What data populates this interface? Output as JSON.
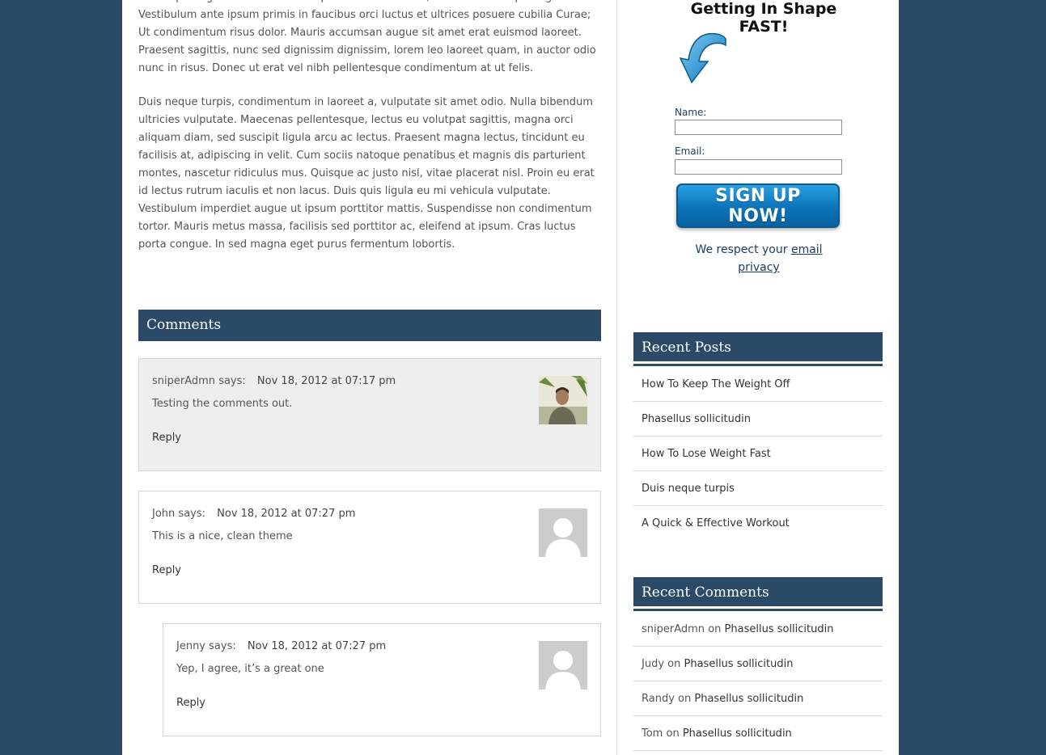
{
  "article": {
    "paragraphs": [
      "nisl adipiscing fermentum. Lorem ipsum dolor sit amet, consectetur adipiscing elit. Vestibulum ante ipsum primis in faucibus orci luctus et ultrices posuere cubilia Curae; Ut condimentum risus dolor. Mauris accumsan augue sit amet erat euismod laoreet. Praesent sagittis, nunc sed dignissim dignissim, lorem leo laoreet quam, in auctor odio nunc in risus. Donec ut erat vel nibh pellentesque condimentum at ut felis.",
      "Duis neque turpis, condimentum in laoreet a, vulputate sit amet odio. Nulla bibendum ultricies vulputate. Maecenas pellentesque, lectus eu volutpat sagittis, magna orci aliquam diam, sed suscipit ligula arcu ac lectus. Praesent magna lectus, tincidunt eu facilisis at, adipiscing in velit. Cum sociis natoque penatibus et magnis dis parturient montes, nascetur ridiculus mus. Quisque ac justo nisl, vitae placerat nisl. Proin eu erat id lectus rutrum iaculis et non lacus. Duis quis ligula eu mi vehicula vulputate. Vestibulum imperdiet augue ut ipsum porttitor mattis. Suspendisse non condimentum tortor. Mauris metus massa, facilisis sed porttitor ac, eleifend at ipsum. Cras luctus porta congue. In sed magna eget purus fermentum lobortis."
    ]
  },
  "comments": {
    "heading": "Comments",
    "items": [
      {
        "author": "sniperAdmn",
        "says": "says:",
        "date": "Nov 18, 2012 at 07:17 pm",
        "text": "Testing the comments out.",
        "reply": "Reply"
      },
      {
        "author": "John",
        "says": "says:",
        "date": "Nov 18, 2012 at 07:27 pm",
        "text": "This is a nice, clean theme",
        "reply": "Reply"
      },
      {
        "author": "Jenny",
        "says": "says:",
        "date": "Nov 18, 2012 at 07:27 pm",
        "text": "Yep, I agree, it’s a great one",
        "reply": "Reply"
      }
    ]
  },
  "optin": {
    "title": "Getting In Shape FAST!",
    "name_label": "Name:",
    "name_value": "",
    "email_label": "Email:",
    "email_value": "",
    "button": "SIGN UP NOW!",
    "privacy_text": "We respect your",
    "privacy_link": "email privacy"
  },
  "recent_posts": {
    "title": "Recent Posts",
    "items": [
      "How To Keep The Weight Off",
      "Phasellus sollicitudin",
      "How To Lose Weight Fast",
      "Duis neque turpis",
      "A Quick & Effective Workout"
    ]
  },
  "recent_comments": {
    "title": "Recent Comments",
    "on": "on",
    "items": [
      {
        "author": "sniperAdmn",
        "post": "Phasellus sollicitudin"
      },
      {
        "author": "Judy",
        "post": "Phasellus sollicitudin"
      },
      {
        "author": "Randy",
        "post": "Phasellus sollicitudin"
      },
      {
        "author": "Tom",
        "post": "Phasellus sollicitudin"
      }
    ]
  },
  "colors": {
    "background": "#2a4a68",
    "heading_bar": "#2a4a68",
    "button": "#0b73b8",
    "link_blue": "#1b3d63"
  }
}
